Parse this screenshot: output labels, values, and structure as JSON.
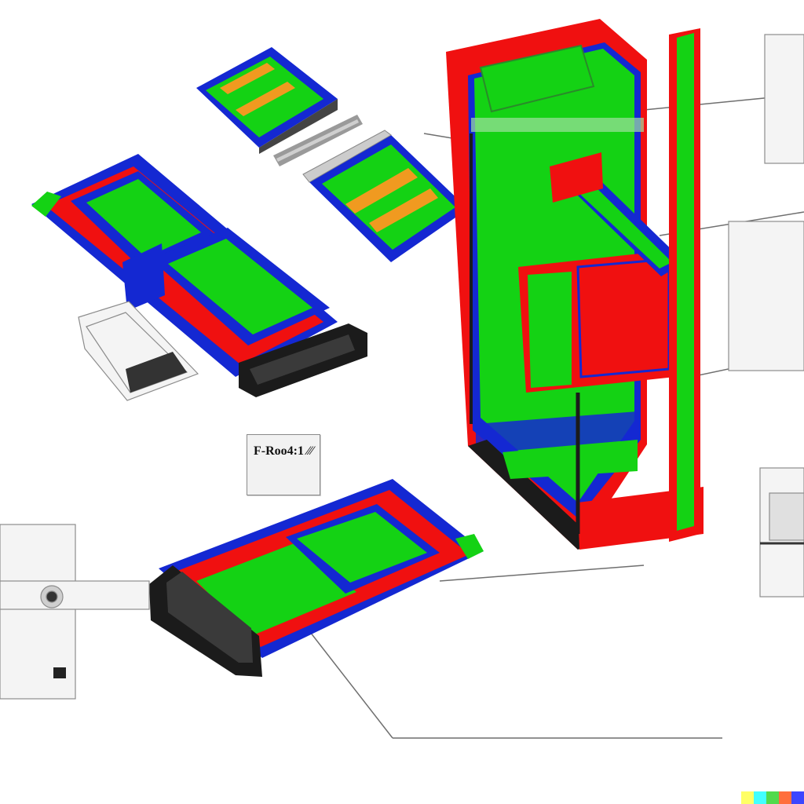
{
  "diagram": {
    "label_text": "F-Roo4:1 ⁄⁄⁄",
    "colors": {
      "red": "#f01010",
      "green": "#14d214",
      "blue": "#1428d2",
      "dark": "#1b1b1b",
      "line": "#6f6f6f",
      "orange": "#f09a20"
    },
    "components": [
      "card-module-top",
      "connector-strip",
      "card-module-tilted",
      "battery-module-large",
      "transparent-tray",
      "tower-cabinet",
      "battery-module-lower",
      "wall-plug-left",
      "switch-panel-right"
    ]
  },
  "watermark": {
    "colors": [
      "#ffff66",
      "#42ffff",
      "#51da4c",
      "#ff6e3c",
      "#3c46ff"
    ]
  }
}
